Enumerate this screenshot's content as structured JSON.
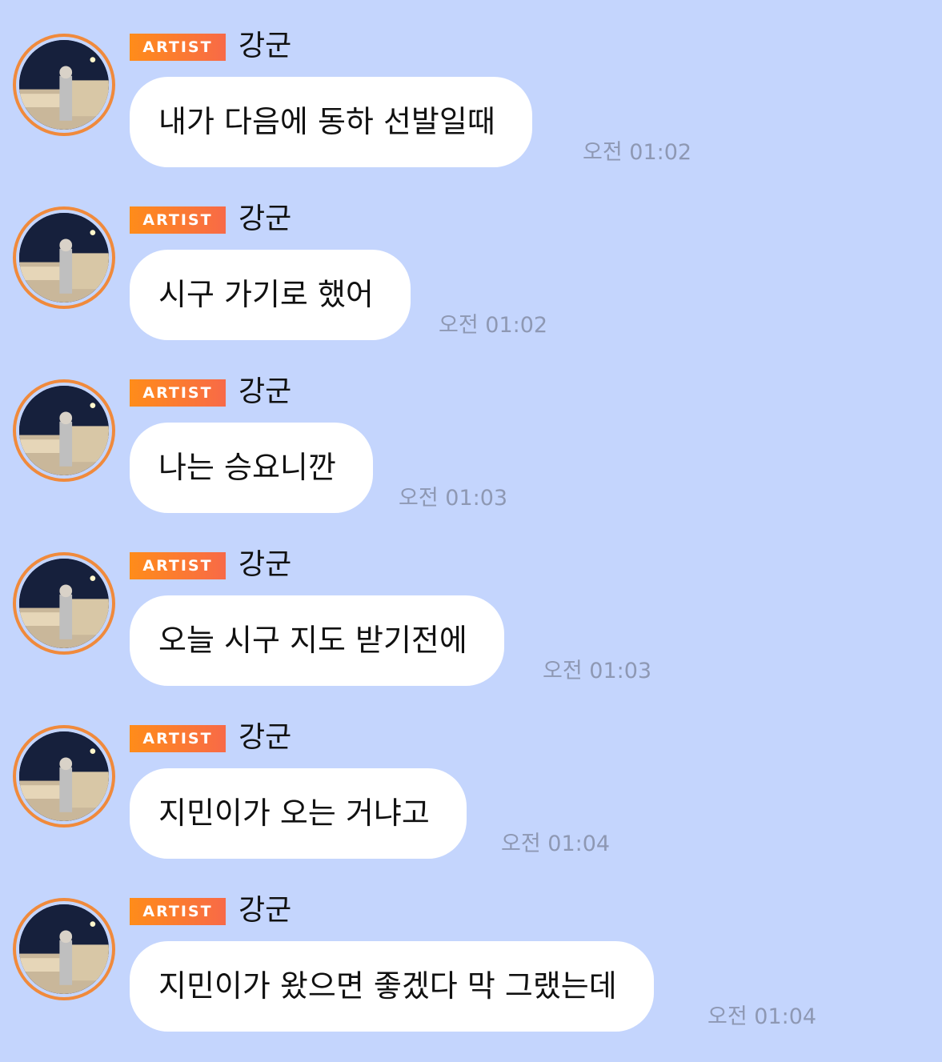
{
  "messages": [
    {
      "badge": "ARTIST",
      "sender": "강군",
      "text": "내가 다음에 동하 선발일때",
      "time": "오전 01:02"
    },
    {
      "badge": "ARTIST",
      "sender": "강군",
      "text": "시구 가기로 했어",
      "time": "오전 01:02"
    },
    {
      "badge": "ARTIST",
      "sender": "강군",
      "text": "나는 승요니깐",
      "time": "오전 01:03"
    },
    {
      "badge": "ARTIST",
      "sender": "강군",
      "text": "오늘 시구 지도 받기전에",
      "time": "오전 01:03"
    },
    {
      "badge": "ARTIST",
      "sender": "강군",
      "text": "지민이가 오는 거냐고",
      "time": "오전 01:04"
    },
    {
      "badge": "ARTIST",
      "sender": "강군",
      "text": "지민이가 왔으면 좋겠다 막 그랬는데",
      "time": "오전 01:04"
    }
  ],
  "colors": {
    "background": "#c4d5fd",
    "bubble": "#ffffff",
    "badge_start": "#ff8c1a",
    "badge_end": "#f86a47",
    "avatar_ring": "#f08a3c",
    "timestamp": "#8e98b3"
  },
  "icons": {
    "avatar": "profile-photo-night-scene"
  }
}
